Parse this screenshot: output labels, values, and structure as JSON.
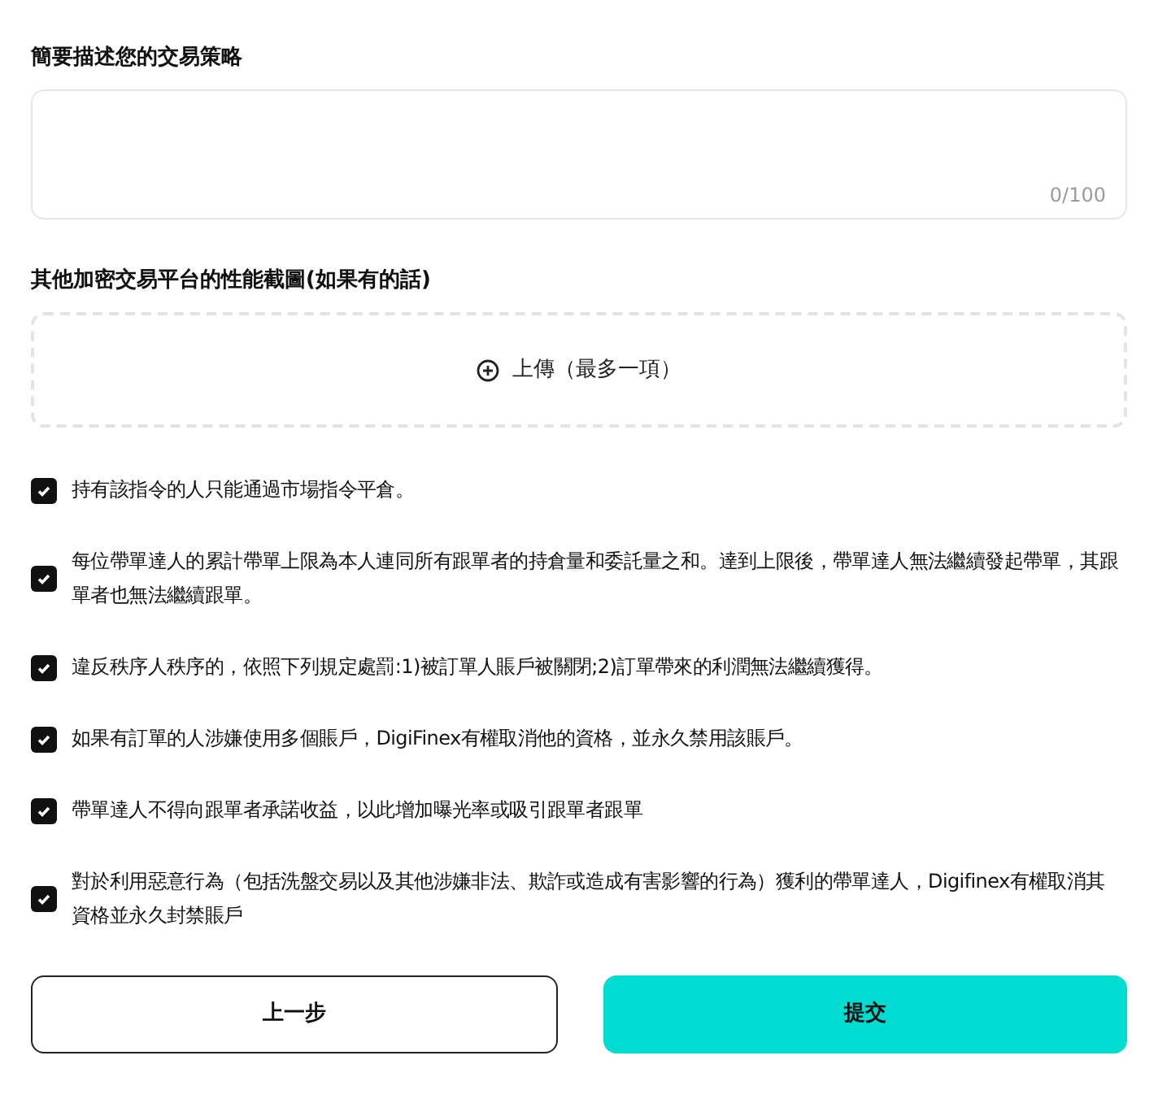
{
  "strategy": {
    "label": "簡要描述您的交易策略",
    "counter": "0/100"
  },
  "upload": {
    "label": "其他加密交易平台的性能截圖(如果有的話)",
    "button": "上傳（最多一項）"
  },
  "agreements": [
    {
      "text": "持有該指令的人只能通過市場指令平倉。",
      "checked": true
    },
    {
      "text": "每位帶單達人的累計帶單上限為本人連同所有跟單者的持倉量和委託量之和。達到上限後，帶單達人無法繼續發起帶單，其跟單者也無法繼續跟單。",
      "checked": true
    },
    {
      "text": "違反秩序人秩序的，依照下列規定處罰:1)被訂單人賬戶被關閉;2)訂單帶來的利潤無法繼續獲得。",
      "checked": true
    },
    {
      "text": "如果有訂單的人涉嫌使用多個賬戶，DigiFinex有權取消他的資格，並永久禁用該賬戶。",
      "checked": true
    },
    {
      "text": "帶單達人不得向跟單者承諾收益，以此增加曝光率或吸引跟單者跟單",
      "checked": true
    },
    {
      "text": "對於利用惡意行為（包括洗盤交易以及其他涉嫌非法、欺詐或造成有害影響的行為）獲利的帶單達人，Digifinex有權取消其資格並永久封禁賬戶",
      "checked": true
    }
  ],
  "buttons": {
    "back": "上一步",
    "submit": "提交"
  }
}
